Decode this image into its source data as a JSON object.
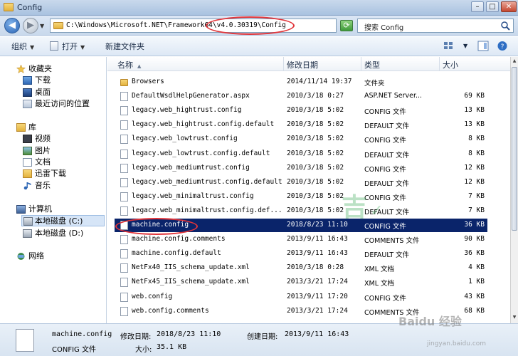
{
  "window": {
    "title": "Config"
  },
  "address": {
    "path": "C:\\Windows\\Microsoft.NET\\Framework64\\v4.0.30319\\Config",
    "search_placeholder": "搜索 Config"
  },
  "toolbar": {
    "organize": "组织",
    "open": "打开",
    "new_folder": "新建文件夹"
  },
  "nav": {
    "favorites": {
      "label": "收藏夹",
      "items": [
        "下载",
        "桌面",
        "最近访问的位置"
      ]
    },
    "libraries": {
      "label": "库",
      "items": [
        "视频",
        "图片",
        "文档",
        "迅雷下载",
        "音乐"
      ]
    },
    "computer": {
      "label": "计算机",
      "items": [
        "本地磁盘 (C:)",
        "本地磁盘 (D:)"
      ]
    },
    "network": {
      "label": "网络"
    }
  },
  "columns": {
    "name": "名称",
    "date": "修改日期",
    "type": "类型",
    "size": "大小"
  },
  "files": [
    {
      "name": "Browsers",
      "date": "2014/11/14 19:37",
      "type": "文件夹",
      "size": "",
      "icon": "folder-icon"
    },
    {
      "name": "DefaultWsdlHelpGenerator.aspx",
      "date": "2010/3/18 0:27",
      "type": "ASP.NET Server...",
      "size": "69 KB",
      "icon": "aspx-file-icon"
    },
    {
      "name": "legacy.web_hightrust.config",
      "date": "2010/3/18 5:02",
      "type": "CONFIG 文件",
      "size": "13 KB",
      "icon": "file-icon"
    },
    {
      "name": "legacy.web_hightrust.config.default",
      "date": "2010/3/18 5:02",
      "type": "DEFAULT 文件",
      "size": "13 KB",
      "icon": "file-icon"
    },
    {
      "name": "legacy.web_lowtrust.config",
      "date": "2010/3/18 5:02",
      "type": "CONFIG 文件",
      "size": "8 KB",
      "icon": "file-icon"
    },
    {
      "name": "legacy.web_lowtrust.config.default",
      "date": "2010/3/18 5:02",
      "type": "DEFAULT 文件",
      "size": "8 KB",
      "icon": "file-icon"
    },
    {
      "name": "legacy.web_mediumtrust.config",
      "date": "2010/3/18 5:02",
      "type": "CONFIG 文件",
      "size": "12 KB",
      "icon": "file-icon"
    },
    {
      "name": "legacy.web_mediumtrust.config.default",
      "date": "2010/3/18 5:02",
      "type": "DEFAULT 文件",
      "size": "12 KB",
      "icon": "file-icon"
    },
    {
      "name": "legacy.web_minimaltrust.config",
      "date": "2010/3/18 5:02",
      "type": "CONFIG 文件",
      "size": "7 KB",
      "icon": "file-icon"
    },
    {
      "name": "legacy.web_minimaltrust.config.def...",
      "date": "2010/3/18 5:02",
      "type": "DEFAULT 文件",
      "size": "7 KB",
      "icon": "file-icon"
    },
    {
      "name": "machine.config",
      "date": "2018/8/23 11:10",
      "type": "CONFIG 文件",
      "size": "36 KB",
      "icon": "file-icon",
      "selected": true
    },
    {
      "name": "machine.config.comments",
      "date": "2013/9/11 16:43",
      "type": "COMMENTS 文件",
      "size": "90 KB",
      "icon": "file-icon"
    },
    {
      "name": "machine.config.default",
      "date": "2013/9/11 16:43",
      "type": "DEFAULT 文件",
      "size": "36 KB",
      "icon": "file-icon"
    },
    {
      "name": "NetFx40_IIS_schema_update.xml",
      "date": "2010/3/18 0:28",
      "type": "XML 文档",
      "size": "4 KB",
      "icon": "xml-file-icon"
    },
    {
      "name": "NetFx45_IIS_schema_update.xml",
      "date": "2013/3/21 17:24",
      "type": "XML 文档",
      "size": "1 KB",
      "icon": "xml-file-icon"
    },
    {
      "name": "web.config",
      "date": "2013/9/11 17:20",
      "type": "CONFIG 文件",
      "size": "43 KB",
      "icon": "file-icon"
    },
    {
      "name": "web.config.comments",
      "date": "2013/3/21 17:24",
      "type": "COMMENTS 文件",
      "size": "68 KB",
      "icon": "file-icon"
    }
  ],
  "details": {
    "filename": "machine.config",
    "modified_label": "修改日期:",
    "modified": "2018/8/23 11:10",
    "created_label": "创建日期:",
    "created": "2013/9/11 16:43",
    "type": "CONFIG 文件",
    "size_label": "大小:",
    "size": "35.1 KB"
  },
  "watermark": {
    "site": "jingyan.baidu.com",
    "brand": "Baidu 经验",
    "logo_text": "吉"
  },
  "colors": {
    "selection": "#0a246a",
    "highlight_ring": "#e1353a"
  }
}
